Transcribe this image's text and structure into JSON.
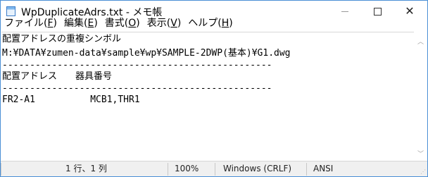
{
  "window": {
    "title": "WpDuplicateAdrs.txt - メモ帳",
    "icon": "notepad-icon"
  },
  "menu": [
    {
      "label": "ファイル(",
      "key": "F",
      "suffix": ")"
    },
    {
      "label": "編集(",
      "key": "E",
      "suffix": ")"
    },
    {
      "label": "書式(",
      "key": "O",
      "suffix": ")"
    },
    {
      "label": "表示(",
      "key": "V",
      "suffix": ")"
    },
    {
      "label": "ヘルプ(",
      "key": "H",
      "suffix": ")"
    }
  ],
  "editor": {
    "lines": [
      "配置アドレスの重複シンボル",
      "M:¥DATA¥zumen-data¥sample¥wp¥SAMPLE-2DWP(基本)¥G1.dwg",
      "-------------------------------------------------",
      "配置アドレス　　器具番号",
      "-------------------------------------------------",
      "FR2-A1          MCB1,THR1"
    ]
  },
  "status": {
    "position": "1 行、1 列",
    "zoom": "100%",
    "line_ending": "Windows (CRLF)",
    "encoding": "ANSI"
  }
}
